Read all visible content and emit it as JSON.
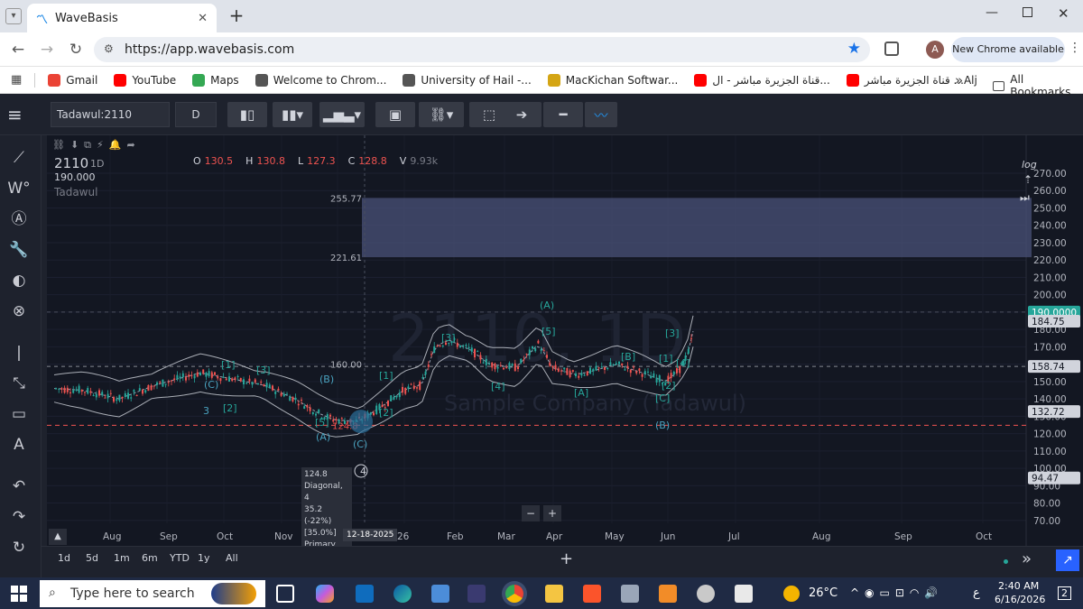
{
  "browser": {
    "tab_title": "WaveBasis",
    "new_tab": "+",
    "url": "https://app.wavebasis.com",
    "update_label": "New Chrome available",
    "profile_initial": "A",
    "bookmarks": [
      {
        "label": "Gmail",
        "icon": "gmail-icon",
        "color": "#ea4335"
      },
      {
        "label": "YouTube",
        "icon": "youtube-icon",
        "color": "#ff0000"
      },
      {
        "label": "Maps",
        "icon": "maps-icon",
        "color": "#34a853"
      },
      {
        "label": "Welcome to Chrom...",
        "icon": "chrome-icon",
        "color": "#555555"
      },
      {
        "label": "University of Hail -...",
        "icon": "globe-icon",
        "color": "#555555"
      },
      {
        "label": "MacKichan Softwar...",
        "icon": "mackichan-icon",
        "color": "#d4a514"
      },
      {
        "label": "قناة الجزيرة مباشر - ال...",
        "icon": "youtube-icon",
        "color": "#ff0000"
      },
      {
        "label": "قناة الجزيرة مباشر ...Alj",
        "icon": "youtube-icon",
        "color": "#ff0000"
      }
    ],
    "more_bookmarks": "»",
    "all_bookmarks": "All Bookmarks"
  },
  "toolbar": {
    "symbol": "Tadawul:2110",
    "interval": "D"
  },
  "chart": {
    "symbol": "2110",
    "interval": "1D",
    "subtitle_value": "190.000",
    "exchange": "Tadawul",
    "watermark": "2110, 1D",
    "watermark_sub": "Sample Company (Tadawul)",
    "ohlc": {
      "o_label": "O",
      "o": "130.5",
      "h_label": "H",
      "h": "130.8",
      "l_label": "L",
      "l": "127.3",
      "c_label": "C",
      "c": "128.8",
      "v_label": "V",
      "v": "9.93k"
    },
    "log_label": "log",
    "y_ticks": [
      "270.00",
      "260.00",
      "250.00",
      "240.00",
      "230.00",
      "220.00",
      "210.00",
      "200.00",
      "190.00",
      "180.00",
      "170.00",
      "160.00",
      "150.00",
      "140.00",
      "130.00",
      "120.00",
      "110.00",
      "100.00",
      "90.00",
      "80.00",
      "70.00"
    ],
    "price_tags": [
      {
        "label": "190.0000",
        "value": 190,
        "color": "#26a69a"
      },
      {
        "label": "184.75",
        "value": 184.75,
        "color": "#d1d4dc"
      },
      {
        "label": "158.74",
        "value": 158.74,
        "color": "#d1d4dc"
      },
      {
        "label": "132.72",
        "value": 132.72,
        "color": "#d1d4dc"
      },
      {
        "label": "94.47",
        "value": 94.47,
        "color": "#d1d4dc"
      }
    ],
    "level_labels": [
      {
        "label": "255.77",
        "value": 255.77
      },
      {
        "label": "221.61",
        "value": 221.61
      },
      {
        "label": "160.00",
        "value": 160
      },
      {
        "label": "124.8",
        "value": 124.8
      }
    ],
    "x_ticks": [
      "Aug",
      "Sep",
      "Oct",
      "Nov",
      "Dec",
      "26",
      "Feb",
      "Mar",
      "Apr",
      "May",
      "Jun",
      "Jul",
      "Aug",
      "Sep",
      "Oct"
    ],
    "crosshair_date": "12-18-2025",
    "tooltip": [
      "124.8",
      "Diagonal, 4",
      "35.2 (-22%)",
      "[35.0%]",
      "Primary"
    ],
    "wave_labels": [
      {
        "t": "(A)",
        "c": "#26a69a"
      },
      {
        "t": "[5]",
        "c": "#26a69a"
      },
      {
        "t": "(B)",
        "c": "#4aa3c0"
      },
      {
        "t": "(C)",
        "c": "#4aa3c0"
      },
      {
        "t": "[1]",
        "c": "#26a69a"
      },
      {
        "t": "[2]",
        "c": "#26a69a"
      },
      {
        "t": "[3]",
        "c": "#26a69a"
      },
      {
        "t": "[4]",
        "c": "#26a69a"
      },
      {
        "t": "[A]",
        "c": "#26a69a"
      },
      {
        "t": "[B]",
        "c": "#26a69a"
      },
      {
        "t": "[C]",
        "c": "#26a69a"
      },
      {
        "t": "(B)",
        "c": "#4aa3c0"
      },
      {
        "t": "(A)",
        "c": "#4aa3c0"
      },
      {
        "t": "[3]",
        "c": "#26a69a"
      },
      {
        "t": "[1]",
        "c": "#26a69a"
      },
      {
        "t": "[4]",
        "c": "#26a69a"
      },
      {
        "t": "[2]",
        "c": "#26a69a"
      },
      {
        "t": "[1]",
        "c": "#26a69a"
      },
      {
        "t": "[2]",
        "c": "#26a69a"
      },
      {
        "t": "[3]",
        "c": "#26a69a"
      },
      {
        "t": "(C)",
        "c": "#4aa3c0"
      },
      {
        "t": "[5]",
        "c": "#26a69a"
      },
      {
        "t": "3",
        "c": "#4aa3c0"
      },
      {
        "t": "4",
        "c": "#d1d4dc"
      }
    ]
  },
  "ranges": [
    "1d",
    "5d",
    "1m",
    "6m",
    "YTD",
    "1y",
    "All"
  ],
  "taskbar": {
    "search_placeholder": "Type here to search",
    "weather": "26°C",
    "time": "2:40 AM",
    "date": "6/16/2026",
    "lang": "ع",
    "notif_count": "2"
  }
}
